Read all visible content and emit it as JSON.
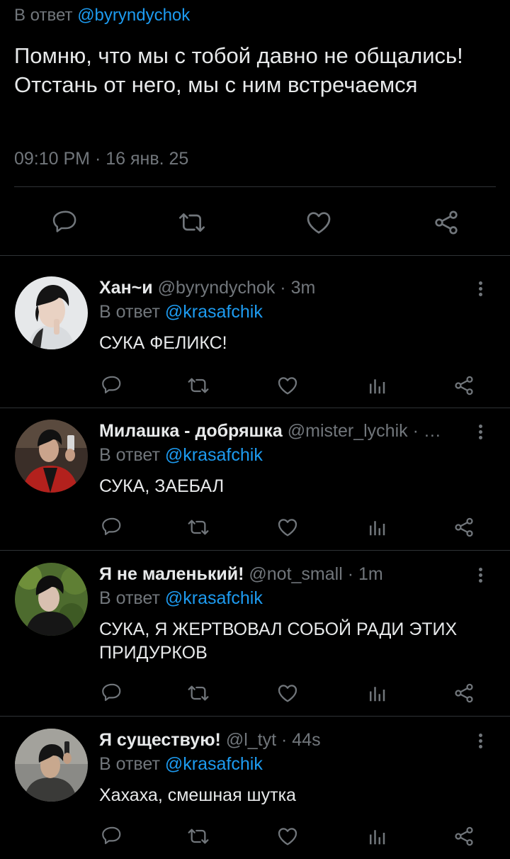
{
  "main_tweet": {
    "reply_prefix": "В ответ",
    "reply_handle": "@byryndychok",
    "text": "Помню, что мы с тобой давно не общались! Отстань от него, мы с ним встречаемся",
    "timestamp": "09:10 PM · 16 янв. 25"
  },
  "replies": [
    {
      "name": "Хан~и",
      "handle": "@byryndychok",
      "time": "3m",
      "reply_prefix": "В ответ",
      "reply_handle": "@krasafchik",
      "text": "СУКА ФЕЛИКС!"
    },
    {
      "name": "Милашка - добряшка",
      "handle": "@mister_lychik",
      "time": "…",
      "reply_prefix": "В ответ",
      "reply_handle": "@krasafchik",
      "text": "СУКА, ЗАЕБАЛ"
    },
    {
      "name": "Я не маленький!",
      "handle": "@not_small",
      "time": "1m",
      "reply_prefix": "В ответ",
      "reply_handle": "@krasafchik",
      "text": "СУКА, Я ЖЕРТВОВАЛ СОБОЙ РАДИ ЭТИХ ПРИДУРКОВ"
    },
    {
      "name": "Я существую!",
      "handle": "@l_tyt",
      "time": "44s",
      "reply_prefix": "В ответ",
      "reply_handle": "@krasafchik",
      "text": "Хахаха, смешная шутка"
    }
  ],
  "colors": {
    "background": "#000000",
    "text": "#e7e9ea",
    "muted": "#71767b",
    "link": "#1d9bf0",
    "divider": "#2f3336"
  },
  "icons": [
    "reply-icon",
    "retweet-icon",
    "like-icon",
    "views-icon",
    "share-icon",
    "more-icon"
  ]
}
